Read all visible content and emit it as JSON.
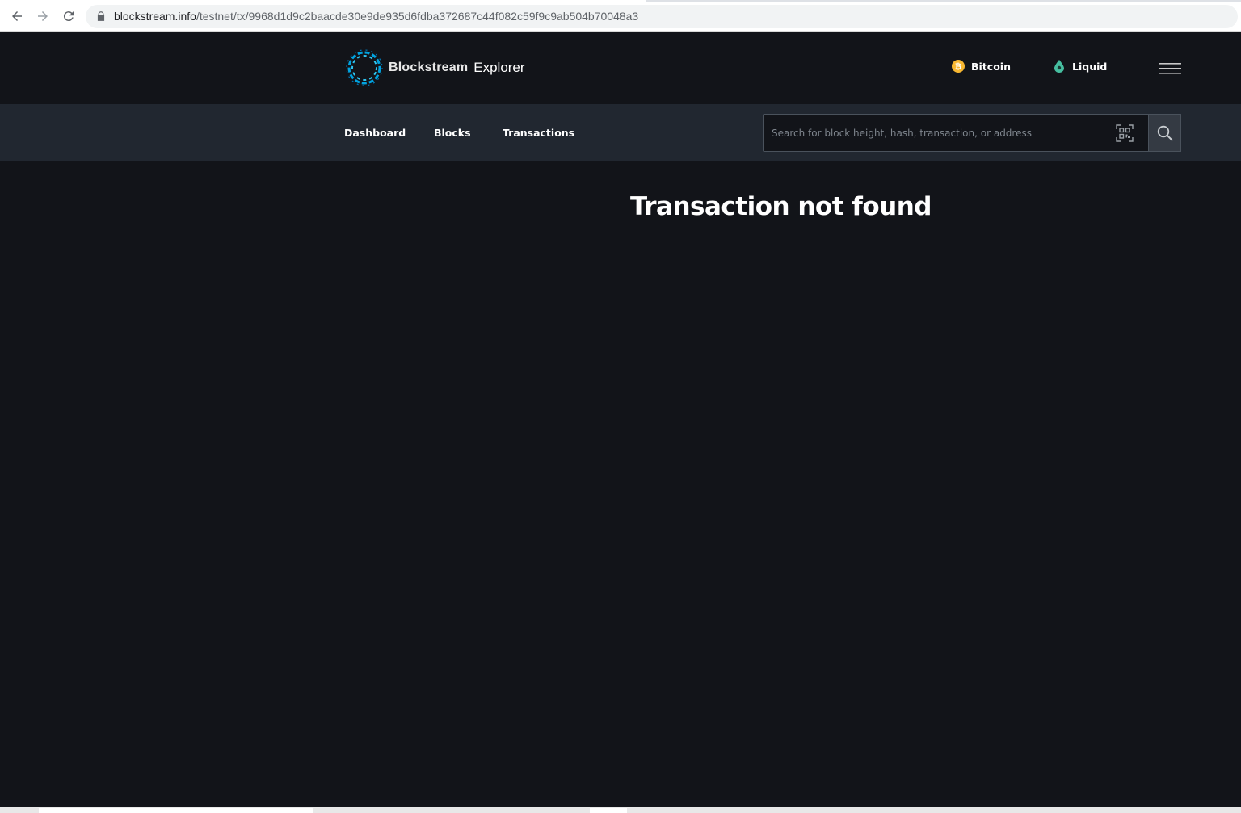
{
  "browser": {
    "url_host": "blockstream.info",
    "url_path": "/testnet/tx/9968d1d9c2baacde30e9de935d6fdba372687c44f082c59f9c9ab504b70048a3"
  },
  "header": {
    "logo_brand": "Blockstream",
    "logo_product": "Explorer",
    "networks": [
      {
        "label": "Bitcoin",
        "icon": "bitcoin-icon",
        "color": "#f7b731"
      },
      {
        "label": "Liquid",
        "icon": "liquid-drop-icon",
        "color": "#46bea0"
      }
    ],
    "menu_icon": "hamburger-menu-icon"
  },
  "nav": {
    "items": [
      {
        "label": "Dashboard"
      },
      {
        "label": "Blocks"
      },
      {
        "label": "Transactions"
      }
    ],
    "search": {
      "placeholder": "Search for block height, hash, transaction, or address",
      "value": ""
    }
  },
  "main": {
    "title": "Transaction not found"
  },
  "colors": {
    "background": "#121419",
    "subnav": "#212730",
    "accent": "#00a3e0"
  }
}
